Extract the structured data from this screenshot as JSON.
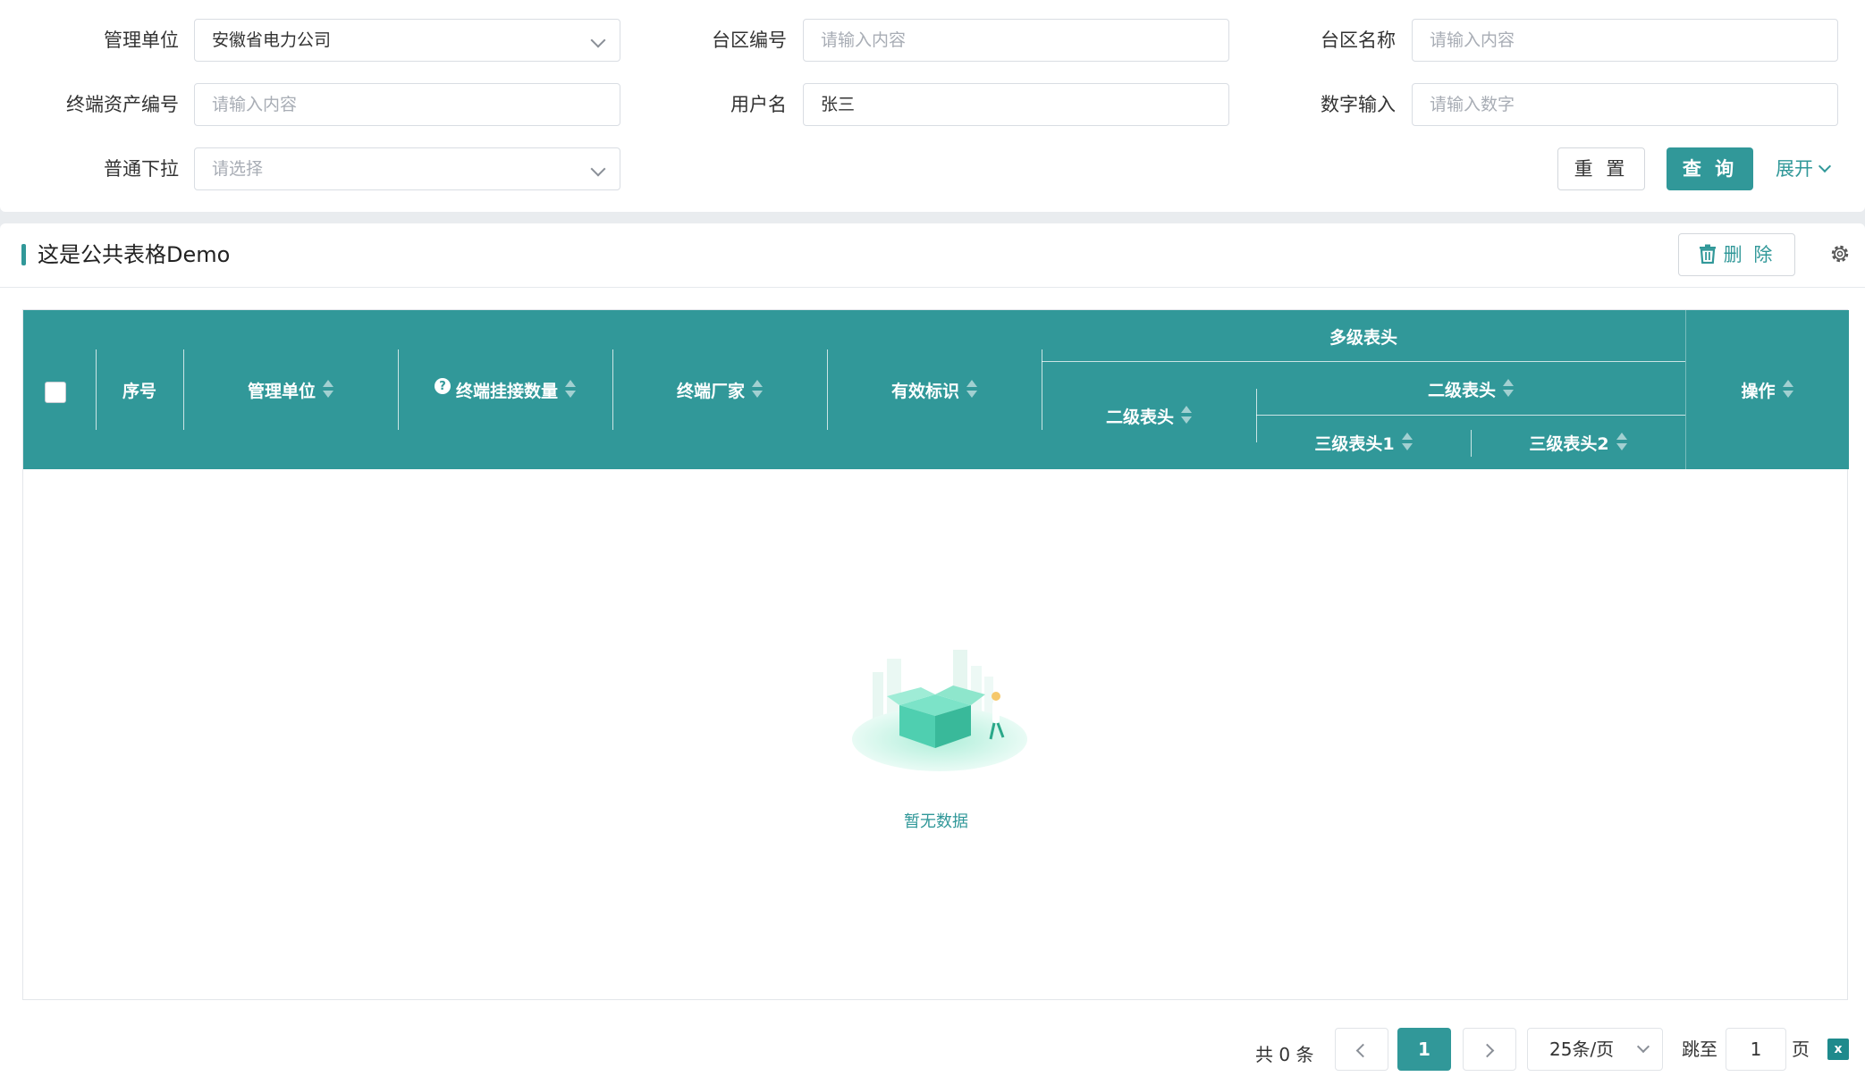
{
  "filters": {
    "mgmt_unit": {
      "label": "管理单位",
      "value": "安徽省电力公司"
    },
    "area_code": {
      "label": "台区编号",
      "placeholder": "请输入内容"
    },
    "area_name": {
      "label": "台区名称",
      "placeholder": "请输入内容"
    },
    "asset_no": {
      "label": "终端资产编号",
      "placeholder": "请输入内容"
    },
    "username": {
      "label": "用户名",
      "value": "张三"
    },
    "number_input": {
      "label": "数字输入",
      "placeholder": "请输入数字"
    },
    "normal_select": {
      "label": "普通下拉",
      "placeholder": "请选择"
    },
    "reset_label": "重 置",
    "query_label": "查 询",
    "expand_label": "展开"
  },
  "table_panel": {
    "title": "这是公共表格Demo",
    "delete_label": "删 除",
    "columns": {
      "index": "序号",
      "mgmt_unit": "管理单位",
      "terminal_count": "终端挂接数量",
      "vendor": "终端厂家",
      "valid_flag": "有效标识",
      "multi_header": "多级表头",
      "level2_a": "二级表头",
      "level2_b": "二级表头",
      "level3_1": "三级表头1",
      "level3_2": "三级表头2",
      "action": "操作"
    },
    "rows": [],
    "empty_text": "暂无数据"
  },
  "pagination": {
    "total_text": "共 0 条",
    "current_page": "1",
    "page_size": "25条/页",
    "jump_label": "跳至",
    "jump_value": "1",
    "page_unit": "页"
  },
  "colors": {
    "accent": "#319899",
    "header_bg": "#319899",
    "border": "#d9dde3"
  }
}
